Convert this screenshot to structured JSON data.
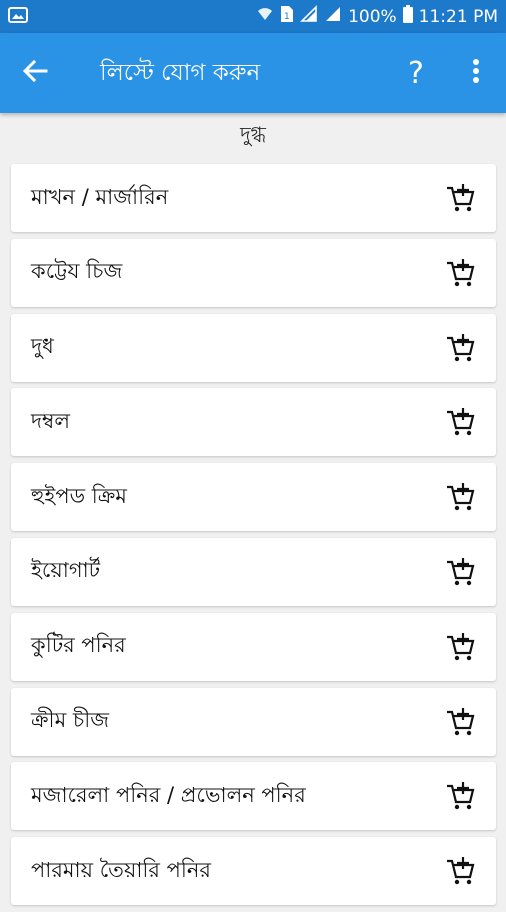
{
  "status_bar": {
    "battery": "100%",
    "time": "11:21 PM",
    "icons": [
      "gallery-icon",
      "wifi-icon",
      "sim-icon",
      "signal-icon",
      "battery-icon"
    ]
  },
  "app_bar": {
    "title": "লিস্টে যোগ করুন",
    "help_label": "?",
    "back_icon": "arrow-left-icon",
    "menu_icon": "more-vert-icon"
  },
  "section": {
    "title": "দুগ্ধ"
  },
  "items": [
    {
      "label": "মাখন / মার্জারিন",
      "icon": "add-to-cart-icon"
    },
    {
      "label": "কট্টেয চিজ",
      "icon": "add-to-cart-icon"
    },
    {
      "label": "দুধ",
      "icon": "add-to-cart-icon"
    },
    {
      "label": "দম্বল",
      "icon": "add-to-cart-icon"
    },
    {
      "label": "হুইপড ক্রিম",
      "icon": "add-to-cart-icon"
    },
    {
      "label": "ইয়োগার্ট",
      "icon": "add-to-cart-icon"
    },
    {
      "label": "কুটির পনির",
      "icon": "add-to-cart-icon"
    },
    {
      "label": "ক্রীম চীজ",
      "icon": "add-to-cart-icon"
    },
    {
      "label": "মজারেলা পনির / প্রভোলন পনির",
      "icon": "add-to-cart-icon"
    },
    {
      "label": "পারমায় তৈয়ারি পনির",
      "icon": "add-to-cart-icon"
    }
  ],
  "colors": {
    "status_bar": "#1d79c9",
    "app_bar": "#2a93e6",
    "background": "#f0f0f0"
  }
}
